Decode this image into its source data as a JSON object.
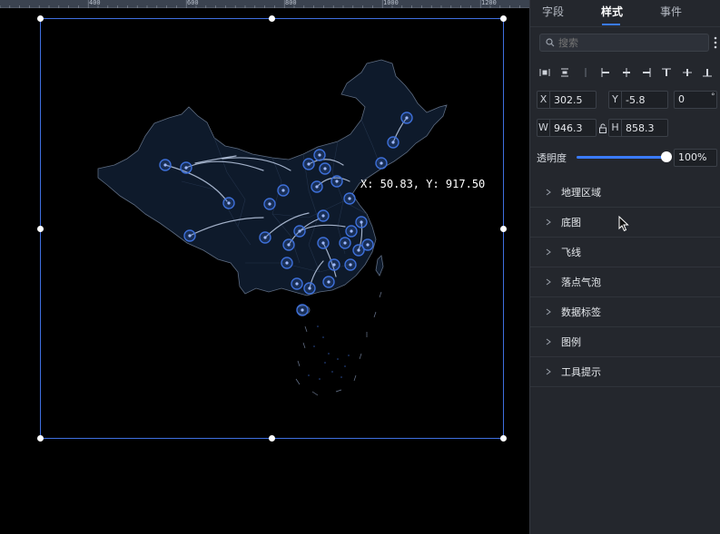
{
  "ruler": {
    "labels": [
      "400",
      "600",
      "800",
      "1000",
      "1200"
    ]
  },
  "canvas": {
    "coord_readout": "X: 50.83, Y: 917.50"
  },
  "panel": {
    "tabs": [
      {
        "label": "字段",
        "active": false
      },
      {
        "label": "样式",
        "active": true
      },
      {
        "label": "事件",
        "active": false
      }
    ],
    "search": {
      "placeholder": "搜索"
    },
    "position": {
      "x_label": "X",
      "x_value": "302.5",
      "y_label": "Y",
      "y_value": "-5.8",
      "rotation_value": "0",
      "rotation_unit": "°",
      "w_label": "W",
      "w_value": "946.3",
      "h_label": "H",
      "h_value": "858.3"
    },
    "opacity": {
      "label": "透明度",
      "value_text": "100%",
      "value": 1.0
    },
    "sections": [
      "地理区域",
      "底图",
      "飞线",
      "落点气泡",
      "数据标签",
      "图例",
      "工具提示"
    ]
  },
  "colors": {
    "accent": "#3a7bff",
    "selection": "#3f6fe0",
    "map_fill": "#0e1a2b",
    "bubble": "#3d6fd8"
  }
}
